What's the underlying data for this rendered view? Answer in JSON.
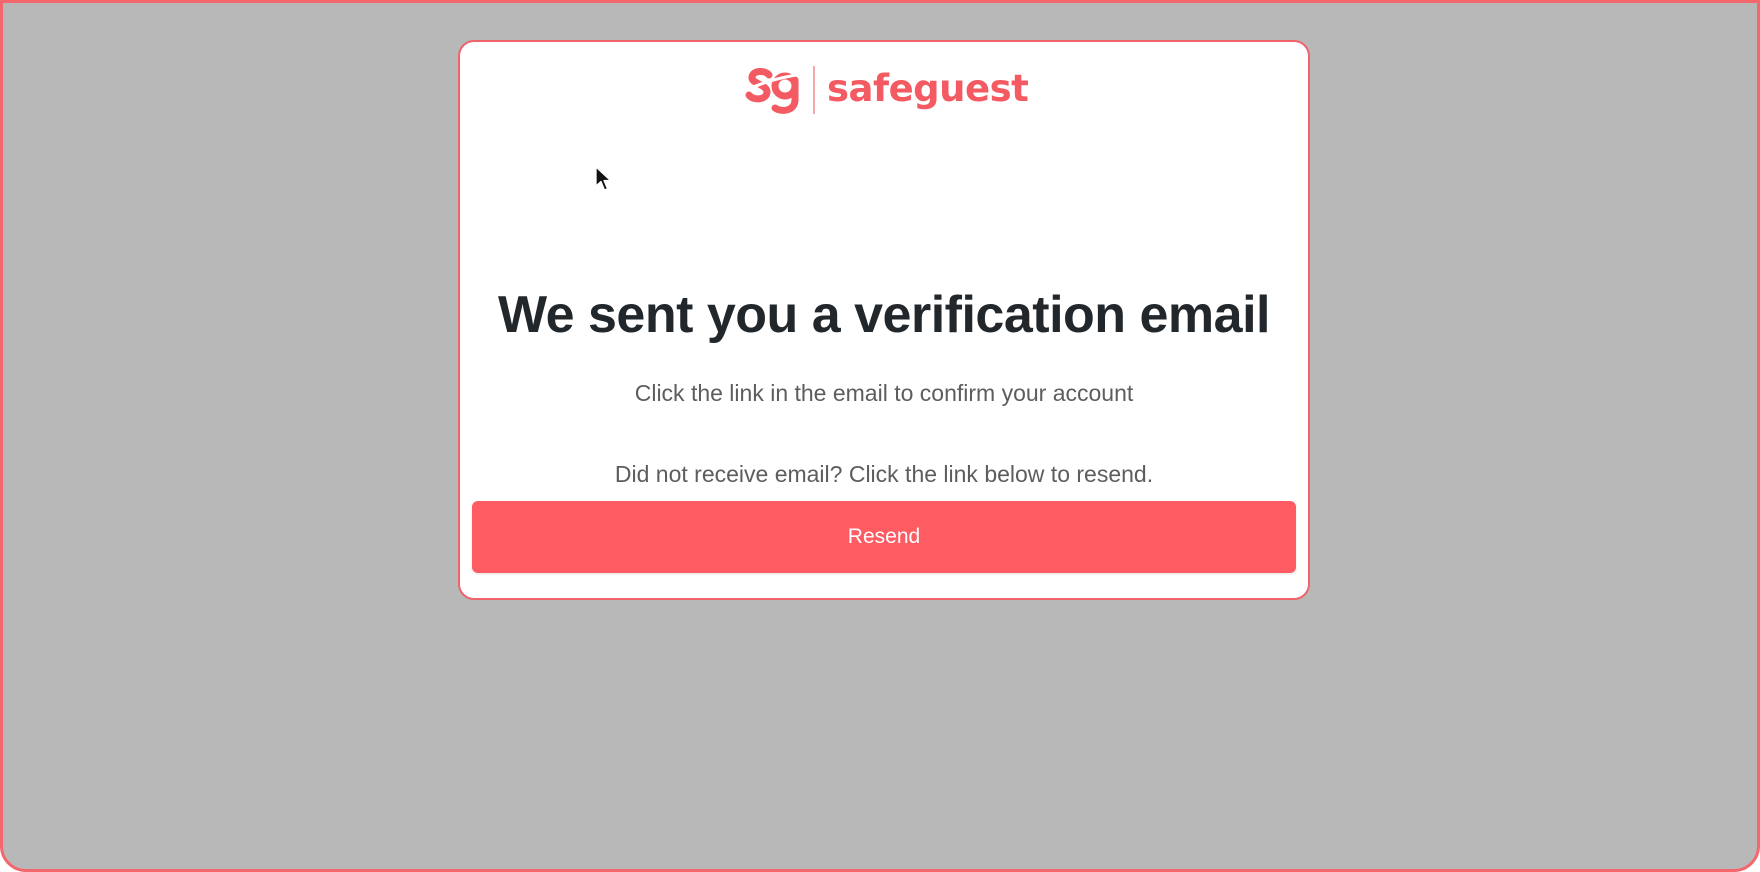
{
  "brand": {
    "name": "safeguest",
    "logo_icon": "sg-monogram-icon",
    "color": "#f35a62"
  },
  "verification": {
    "title": "We sent you a verification email",
    "subtitle": "Click the link in the email to confirm your account",
    "resend_hint": "Did not receive email? Click the link below to resend.",
    "resend_label": "Resend"
  },
  "colors": {
    "accent": "#fe5b63",
    "overlay": "#b8b8b8",
    "title_text": "#22272b",
    "body_text": "#5d5d5d"
  },
  "cursor_icon": "mouse-pointer-icon"
}
